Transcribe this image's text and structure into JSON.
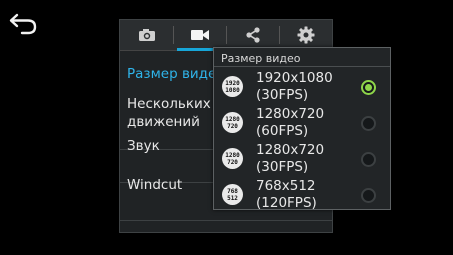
{
  "settings": {
    "tabs": [
      {
        "icon": "camera-icon",
        "active": false
      },
      {
        "icon": "video-camera-icon",
        "active": true
      },
      {
        "icon": "share-icon",
        "active": false
      },
      {
        "icon": "gear-icon",
        "active": false
      }
    ],
    "rows": [
      {
        "label": "Размер видео"
      },
      {
        "label": "Нескольких движений"
      },
      {
        "label": "Звук"
      },
      {
        "label": "Windcut"
      }
    ]
  },
  "popup": {
    "title": "Размер видео",
    "options": [
      {
        "icon_top": "1920",
        "icon_bottom": "1080",
        "label_line1": "1920x1080",
        "label_line2": "(30FPS)",
        "selected": true
      },
      {
        "icon_top": "1280",
        "icon_bottom": "720",
        "label_line1": "1280x720",
        "label_line2": "(60FPS)",
        "selected": false
      },
      {
        "icon_top": "1280",
        "icon_bottom": "720",
        "label_line1": "1280x720",
        "label_line2": "(30FPS)",
        "selected": false
      },
      {
        "icon_top": "768",
        "icon_bottom": "512",
        "label_line1": "768x512",
        "label_line2": "(120FPS)",
        "selected": false
      }
    ]
  },
  "colors": {
    "accent": "#17a6d8",
    "selected_radio": "#8fd64a"
  }
}
